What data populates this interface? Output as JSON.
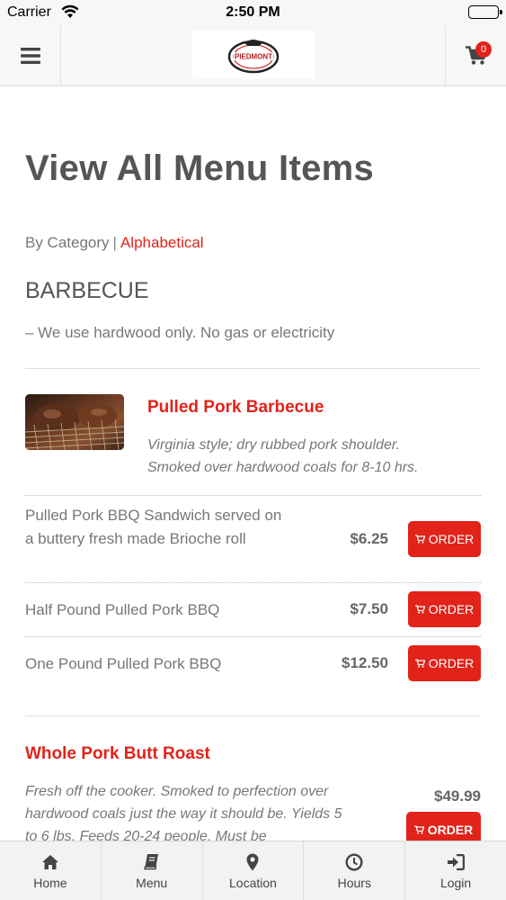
{
  "status_bar": {
    "carrier": "Carrier",
    "time": "2:50 PM"
  },
  "navbar": {
    "cart_count": "0",
    "logo_text": "PIEDMONT"
  },
  "page": {
    "title": "View All Menu Items",
    "filter_by_category": "By Category",
    "filter_separator": "|",
    "filter_alphabetical": "Alphabetical"
  },
  "section": {
    "title": "BARBECUE",
    "description": "– We use hardwood only. No gas or electricity"
  },
  "items": [
    {
      "name": "Pulled Pork Barbecue",
      "description": "Virginia style; dry rubbed pork shoulder. Smoked over hardwood coals for 8-10 hrs.",
      "variants": [
        {
          "label": "Pulled Pork BBQ Sandwich served on a buttery fresh made Brioche roll",
          "price": "$6.25",
          "button": "ORDER"
        },
        {
          "label": "Half Pound Pulled Pork BBQ",
          "price": "$7.50",
          "button": "ORDER"
        },
        {
          "label": "One Pound Pulled Pork BBQ",
          "price": "$12.50",
          "button": "ORDER"
        }
      ]
    },
    {
      "name": "Whole Pork Butt Roast",
      "description": "Fresh off the cooker. Smoked to perfection over hardwood coals just the way it should be. Yields 5 to 6 lbs. Feeds 20-24 people. Must be",
      "price": "$49.99",
      "button": "ORDER"
    }
  ],
  "tabbar": [
    {
      "label": "Home",
      "icon": "home-icon"
    },
    {
      "label": "Menu",
      "icon": "book-icon"
    },
    {
      "label": "Location",
      "icon": "map-pin-icon"
    },
    {
      "label": "Hours",
      "icon": "clock-icon"
    },
    {
      "label": "Login",
      "icon": "sign-in-icon"
    }
  ],
  "colors": {
    "accent": "#e2231a",
    "text": "#555555",
    "muted": "#777777"
  }
}
